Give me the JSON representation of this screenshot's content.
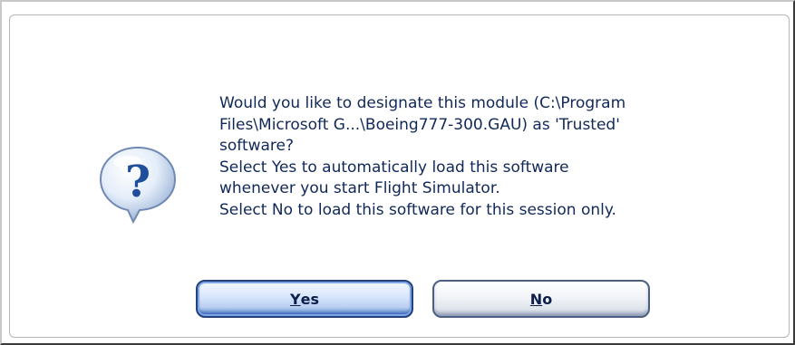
{
  "dialog": {
    "icon": "question-balloon-icon",
    "message_lines": [
      "Would you like to designate this module (C:\\Program",
      "Files\\Microsoft G...\\Boeing777-300.GAU) as 'Trusted'",
      "software?",
      "Select Yes to automatically load this software",
      "whenever you start Flight Simulator.",
      "Select No to load this software for this session only."
    ],
    "buttons": {
      "yes": {
        "mnemonic": "Y",
        "rest": "es",
        "label": "Yes"
      },
      "no": {
        "mnemonic": "N",
        "rest": "o",
        "label": "No"
      }
    }
  },
  "colors": {
    "text": "#10285a",
    "icon_fill": "#1f4f9c",
    "default_button_border": "#22427c"
  }
}
